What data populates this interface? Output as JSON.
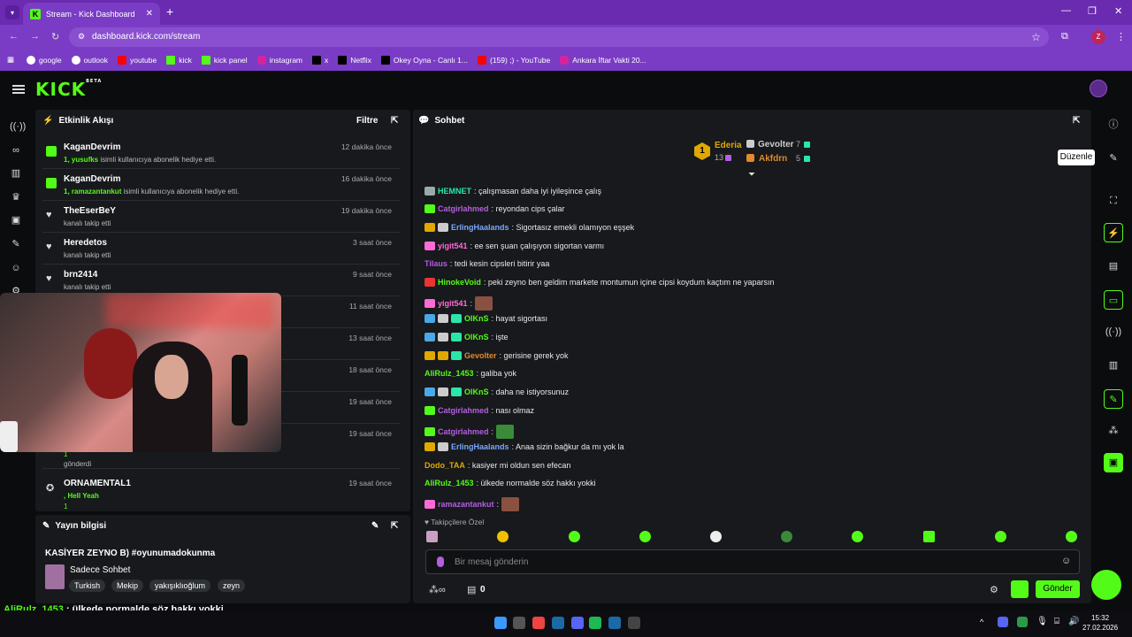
{
  "browser": {
    "tab_title": "Stream - Kick Dashboard",
    "url": "dashboard.kick.com/stream",
    "bookmarks": [
      "google",
      "outlook",
      "youtube",
      "kick",
      "kick panel",
      "instagram",
      "x",
      "Netflix",
      "Okey Oyna - Canlı 1...",
      "(159) ;) - YouTube",
      "Ankara İftar Vakti 20..."
    ],
    "profile_letter": "Z"
  },
  "app": {
    "logo": "KICK",
    "logo_beta": "BETA"
  },
  "activity": {
    "title": "Etkinlik Akışı",
    "filter": "Filtre",
    "events": [
      {
        "name": "KaganDevrim",
        "time": "12 dakika önce",
        "user": "1, yusufks",
        "desc": " isimli kullanıcıya abonelik hediye etti.",
        "icon": "gift"
      },
      {
        "name": "KaganDevrim",
        "time": "16 dakika önce",
        "user": "1, ramazantankut",
        "desc": " isimli kullanıcıya abonelik hediye etti.",
        "icon": "gift"
      },
      {
        "name": "TheEserBeY",
        "time": "19 dakika önce",
        "user": "",
        "desc": "kanalı takip etti",
        "icon": "heart"
      },
      {
        "name": "Heredetos",
        "time": "3 saat önce",
        "user": "",
        "desc": "kanalı takip etti",
        "icon": "heart"
      },
      {
        "name": "brn2414",
        "time": "9 saat önce",
        "user": "",
        "desc": "kanalı takip etti",
        "icon": "heart"
      }
    ],
    "hidden_times": [
      "11 saat önce",
      "13 saat önce",
      "18 saat önce",
      "19 saat önce",
      "19 saat önce"
    ],
    "partial_count": "1",
    "partial_desc": "gönderdi",
    "last_event": {
      "name": "ORNAMENTAL1",
      "time": "19 saat önce",
      "user": ", Hell Yeah",
      "count": "1"
    }
  },
  "stream_info": {
    "title": "Yayın bilgisi",
    "stream_title": "KASİYER ZEYNO B) #oyunumadokunma",
    "category": "Sadece Sohbet",
    "tags": [
      "Turkish",
      "Mekip",
      "yakışıklıoğlum",
      "zeyn"
    ]
  },
  "chat": {
    "title": "Sohbet",
    "pinned": {
      "first": "Ederia",
      "first_count": "13",
      "first_rank": "1",
      "second": "Gevolter",
      "second_count": "7",
      "third": "Akfdrn",
      "third_count": "5"
    },
    "messages": [
      {
        "user": "HEMNET",
        "color": "#2ce6a8",
        "text": ": çalışmasan daha iyi iyileşince çalış",
        "badges": [
          "#9aa"
        ]
      },
      {
        "user": "Catgirlahmed",
        "color": "#b45ee0",
        "text": ": reyondan cips çalar",
        "badges": [
          "#53fc18"
        ]
      },
      {
        "user": "ErlingHaalands",
        "color": "#7aa6ff",
        "text": ": Sigortasız emekli olamıyon eşşek",
        "badges": [
          "#e0a800",
          "#ccc"
        ]
      },
      {
        "user": "yigit541",
        "color": "#ff6bd5",
        "text": ": ee sen şuan çalışıyon sigortan varmı",
        "badges": [
          "#ff6bd5"
        ]
      },
      {
        "user": "Tilaus",
        "color": "#b45ee0",
        "text": ": tedi kesin cipsleri bitirir yaa",
        "badges": []
      },
      {
        "user": "HinokeVoid",
        "color": "#53fc18",
        "text": ": peki zeyno ben geldim markete montumun içine cipsi koydum kaçtım ne yaparsın",
        "badges": [
          "#e33"
        ]
      },
      {
        "user": "yigit541",
        "color": "#ff6bd5",
        "text": ":",
        "badges": [
          "#ff6bd5"
        ],
        "emote": true
      },
      {
        "user": "OlKnS",
        "color": "#53fc18",
        "text": ": hayat sigortası",
        "badges": [
          "#4aa8e8",
          "#ccc",
          "#2ce6a8"
        ]
      },
      {
        "user": "OlKnS",
        "color": "#53fc18",
        "text": ": işte",
        "badges": [
          "#4aa8e8",
          "#ccc",
          "#2ce6a8"
        ]
      },
      {
        "user": "Gevolter",
        "color": "#e08a2c",
        "text": ": gerisine gerek yok",
        "badges": [
          "#e0a800",
          "#e0a800",
          "#2ce6a8"
        ]
      },
      {
        "user": "AliRulz_1453",
        "color": "#53fc18",
        "text": ": galiba yok",
        "badges": []
      },
      {
        "user": "OlKnS",
        "color": "#53fc18",
        "text": ": daha ne istiyorsunuz",
        "badges": [
          "#4aa8e8",
          "#ccc",
          "#2ce6a8"
        ]
      },
      {
        "user": "Catgirlahmed",
        "color": "#b45ee0",
        "text": ": nası olmaz",
        "badges": [
          "#53fc18"
        ]
      },
      {
        "user": "Catgirlahmed",
        "color": "#b45ee0",
        "text": ":",
        "badges": [
          "#53fc18"
        ],
        "emote": true
      },
      {
        "user": "ErlingHaalands",
        "color": "#7aa6ff",
        "text": ": Anaa sizin bağkur da mı yok la",
        "badges": [
          "#e0a800",
          "#ccc"
        ]
      },
      {
        "user": "Dodo_TAA",
        "color": "#e0a800",
        "text": ": kasiyer mi oldun sen efecan",
        "badges": []
      },
      {
        "user": "AliRulz_1453",
        "color": "#53fc18",
        "text": ": ülkede normalde söz hakkı yokki",
        "badges": []
      },
      {
        "user": "ramazantankut",
        "color": "#b45ee0",
        "text": ":",
        "badges": [
          "#ff6bd5"
        ],
        "emote": true
      }
    ],
    "emote_label": "Takipçilere Özel",
    "input_placeholder": "Bir mesaj gönderin",
    "points": "0",
    "send": "Gönder",
    "edit_tooltip": "Düzenle"
  },
  "overlay": [
    {
      "user": "AliRulz_1453",
      "text": " : ülkede normalde söz hakkı yokki"
    },
    {
      "user": "ramazantankut",
      "text": " :"
    }
  ],
  "taskbar": {
    "time": "15:32",
    "date": "27.02.2026"
  }
}
